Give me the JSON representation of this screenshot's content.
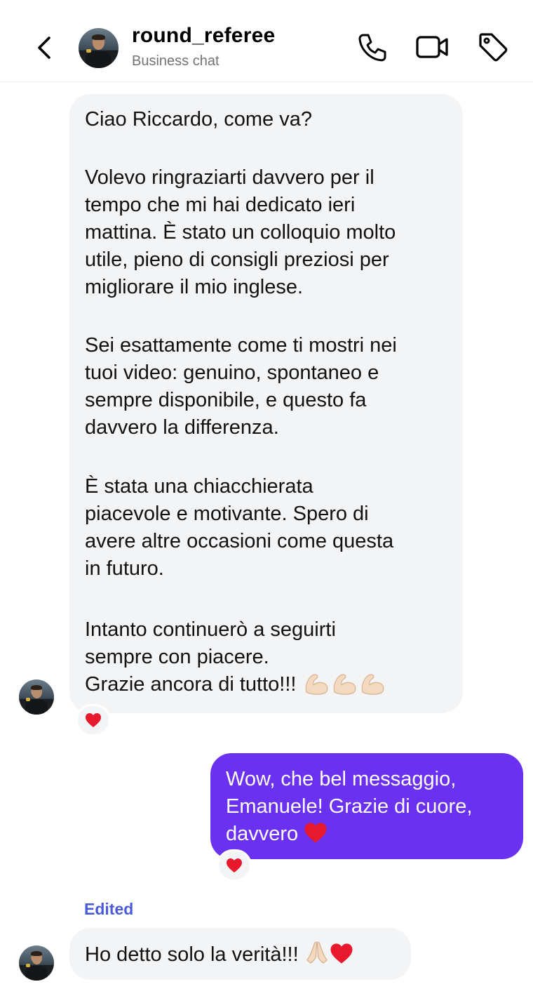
{
  "header": {
    "username": "round_referee",
    "subtitle": "Business chat",
    "icons": [
      "back-chevron-icon",
      "phone-icon",
      "video-camera-icon",
      "tag-icon"
    ]
  },
  "messages": [
    {
      "direction": "incoming",
      "paragraphs": [
        "Ciao Riccardo, come va?",
        "Volevo ringraziarti davvero per il\ntempo che mi hai dedicato ieri\nmattina. È stato un colloquio molto\nutile, pieno di consigli preziosi per\nmigliorare il mio inglese.",
        "Sei esattamente come ti mostri nei\ntuoi video: genuino, spontaneo e\nsempre disponibile, e questo fa\ndavvero la differenza.",
        "È stata una chiacchierata\npiacevole e motivante. Spero di\navere altre occasioni come questa\nin futuro.",
        "Intanto continuerò a seguirti\nsempre con piacere.\nGrazie ancora di tutto!!!"
      ],
      "trailing_emoji": [
        "flexed-biceps-emoji",
        "flexed-biceps-emoji",
        "flexed-biceps-emoji"
      ],
      "reaction": "red-heart-emoji"
    },
    {
      "direction": "outgoing",
      "text": "Wow, che bel messaggio,\nEmanuele! Grazie di cuore,\ndavvero",
      "trailing_emoji": [
        "red-heart-emoji"
      ],
      "reaction": "red-heart-emoji"
    },
    {
      "direction": "incoming",
      "edited_label": "Edited",
      "text": "Ho detto solo la verità!!!",
      "trailing_emoji": [
        "folded-hands-emoji",
        "red-heart-emoji"
      ]
    }
  ],
  "colors": {
    "incoming_bubble": "#f3f4f6",
    "outgoing_bubble": "#6a31f0",
    "edited_label": "#4b5bd6",
    "subtitle": "#737373"
  }
}
